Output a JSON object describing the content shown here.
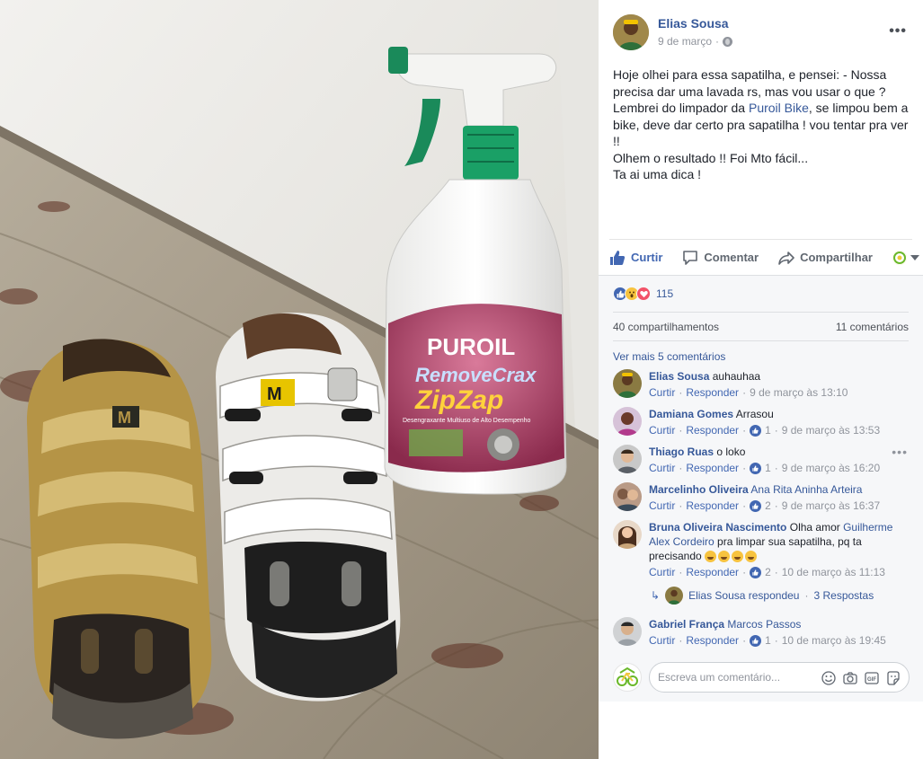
{
  "photo": {
    "bottle_brand": "PUROIL",
    "bottle_product_line1": "RemoveCrax",
    "bottle_product_line2": "ZipZap",
    "bottle_tagline": "Desengraxante Multiuso de Alto Desempenho",
    "shoe_logo": "M"
  },
  "post": {
    "author": "Elias Sousa",
    "date": "9 de março",
    "text_part1": "Hoje olhei para essa sapatilha, e pensei: - Nossa precisa dar uma lavada rs, mas vou usar o que ? Lembrei do limpador da ",
    "text_link": "Puroil Bike",
    "text_part2": ", se limpou bem a bike, deve dar certo pra sapatilha ! vou tentar pra ver !!\nOlhem o resultado !! Foi Mto fácil...\nTa ai uma dica !",
    "more_icon": "more-horizontal-icon",
    "privacy_icon": "globe-icon"
  },
  "actions": {
    "like": "Curtir",
    "comment": "Comentar",
    "share": "Compartilhar"
  },
  "stats": {
    "reaction_count": "115",
    "shares": "40 compartilhamentos",
    "comments": "11 comentários",
    "view_more": "Ver mais 5 comentários"
  },
  "comments": [
    {
      "name": "Elias Sousa",
      "tag": "",
      "text": "auhauhaa",
      "like": "Curtir",
      "reply": "Responder",
      "likes": "",
      "time": "9 de março às 13:10",
      "avatar_color": "#8a7a42"
    },
    {
      "name": "Damiana Gomes",
      "tag": "",
      "text": "Arrasou",
      "like": "Curtir",
      "reply": "Responder",
      "likes": "1",
      "time": "9 de março às 13:53",
      "avatar_color": "#b23a8c"
    },
    {
      "name": "Thiago Ruas",
      "tag": "",
      "text": "o loko",
      "like": "Curtir",
      "reply": "Responder",
      "likes": "1",
      "time": "9 de março às 16:20",
      "avatar_color": "#5a5f66"
    },
    {
      "name": "Marcelinho Oliveira",
      "tag": "Ana Rita Aninha Arteira",
      "text": "",
      "like": "Curtir",
      "reply": "Responder",
      "likes": "2",
      "time": "9 de março às 16:37",
      "avatar_color": "#7d5a45"
    },
    {
      "name": "Bruna Oliveira Nascimento",
      "tag": "",
      "text_before": "Olha amor ",
      "tag2": "Guilherme Alex Cordeiro",
      "text_after": " pra limpar sua sapatilha, pq ta precisando ",
      "like": "Curtir",
      "reply": "Responder",
      "likes": "2",
      "time": "10 de março às 11:13",
      "avatar_color": "#c9a57a"
    },
    {
      "name": "Gabriel França",
      "tag": "Marcos Passos",
      "text": "",
      "like": "Curtir",
      "reply": "Responder",
      "likes": "1",
      "time": "10 de março às 19:45",
      "avatar_color": "#9aa0a6"
    }
  ],
  "reply_summary": {
    "author": "Elias Sousa respondeu",
    "count": "3 Respostas"
  },
  "composer": {
    "placeholder": "Escreva um comentário...",
    "icons": [
      "smiley-icon",
      "camera-icon",
      "gif-icon",
      "sticker-icon"
    ]
  },
  "colors": {
    "accent": "#4267b2",
    "link": "#365899",
    "panel_bg": "#f6f7f9"
  }
}
